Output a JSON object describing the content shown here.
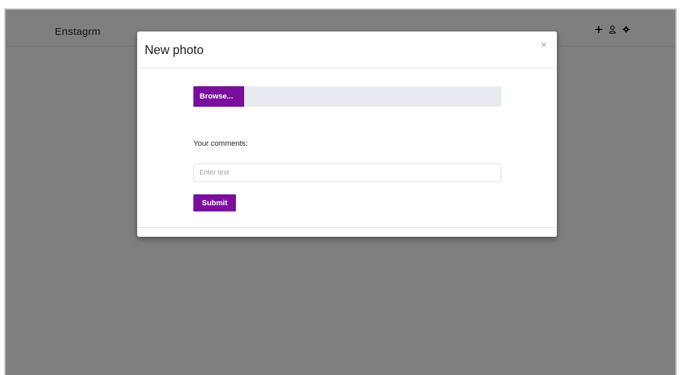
{
  "navbar": {
    "brand": "Enstagrm",
    "icons": [
      {
        "name": "plus-icon",
        "glyph": "+"
      },
      {
        "name": "user-icon",
        "glyph": "👤"
      },
      {
        "name": "gear-icon",
        "glyph": "⚙"
      }
    ]
  },
  "modal": {
    "title": "New photo",
    "close_label": "×",
    "browse_label": "Browse...",
    "file_name": "",
    "comments_label": "Your comments:",
    "comment_input": {
      "value": "",
      "placeholder": "Enter text"
    },
    "submit_label": "Submit"
  },
  "colors": {
    "accent": "#7a0f9e",
    "backdrop": "#808080",
    "file_field_bg": "#e9ecef"
  }
}
